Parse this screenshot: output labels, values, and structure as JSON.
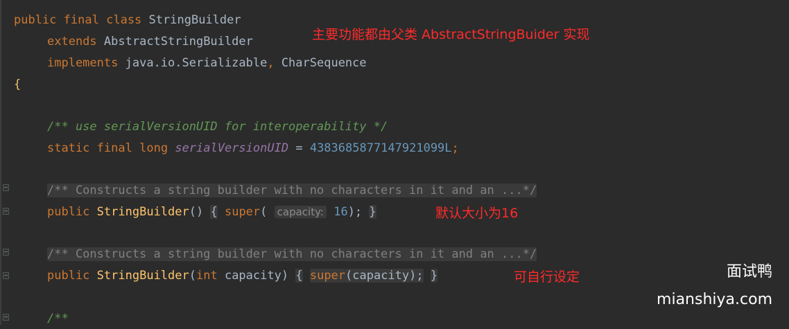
{
  "code": {
    "l1": {
      "kw1": "public",
      "kw2": "final",
      "kw3": "class",
      "name": "StringBuilder"
    },
    "l2": {
      "kw": "extends",
      "name": "AbstractStringBuilder"
    },
    "l3": {
      "kw": "implements",
      "name1": "java.io.Serializable",
      "sep": ",",
      "name2": "CharSequence"
    },
    "l4": {
      "brace": "{"
    },
    "l5": {
      "comment": "/** use serialVersionUID for interoperability */"
    },
    "l6": {
      "kw1": "static",
      "kw2": "final",
      "kw3": "long",
      "field": "serialVersionUID",
      "eq": "=",
      "value": "4383685877147921099L",
      "semi": ";"
    },
    "l7": {
      "comment": "/** Constructs a string builder with no characters in it and an ...*/"
    },
    "l8": {
      "kw": "public",
      "name": "StringBuilder",
      "parens": "()",
      "open": "{",
      "super_kw": "super",
      "paren_open": "(",
      "hint": "capacity:",
      "arg": "16",
      "paren_close": ");",
      "close": "}"
    },
    "l9": {
      "comment": "/** Constructs a string builder with no characters in it and an ...*/"
    },
    "l10": {
      "kw": "public",
      "name": "StringBuilder",
      "paren_open": "(",
      "type": "int",
      "param": "capacity",
      "paren_close": ")",
      "open": "{",
      "super_kw": "super",
      "call": "(capacity);",
      "close": "}"
    },
    "l11": {
      "comment": "/**"
    }
  },
  "annotations": {
    "parent_class": "主要功能都由父类 AbstractStringBuider 实现",
    "default_size": "默认大小为16",
    "custom_size": "可自行设定"
  },
  "watermark": {
    "name": "面试鸭",
    "url": "mianshiya.com"
  },
  "colors": {
    "background": "#2b2b2b",
    "keyword": "#cc7832",
    "doc_comment": "#629755",
    "comment": "#808080",
    "number": "#6897bb",
    "field": "#9876aa",
    "method": "#ffc66d",
    "annotation_red": "#ff2b2b"
  }
}
